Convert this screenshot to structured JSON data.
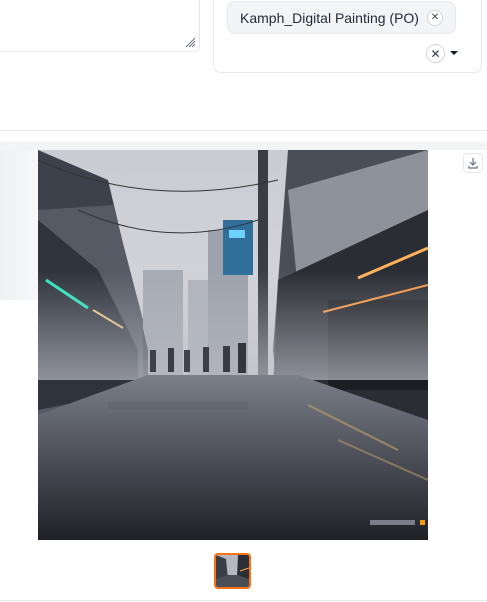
{
  "style_selector": {
    "selected_chips": [
      {
        "label": "Kamph_Digital Painting (PO)"
      }
    ]
  },
  "gallery": {
    "main_image": {
      "alt": ""
    },
    "thumbnails_count": 1
  },
  "colors": {
    "accent": "#f97316",
    "border": "#e5e7eb",
    "chip_bg": "#f3f4f6"
  }
}
